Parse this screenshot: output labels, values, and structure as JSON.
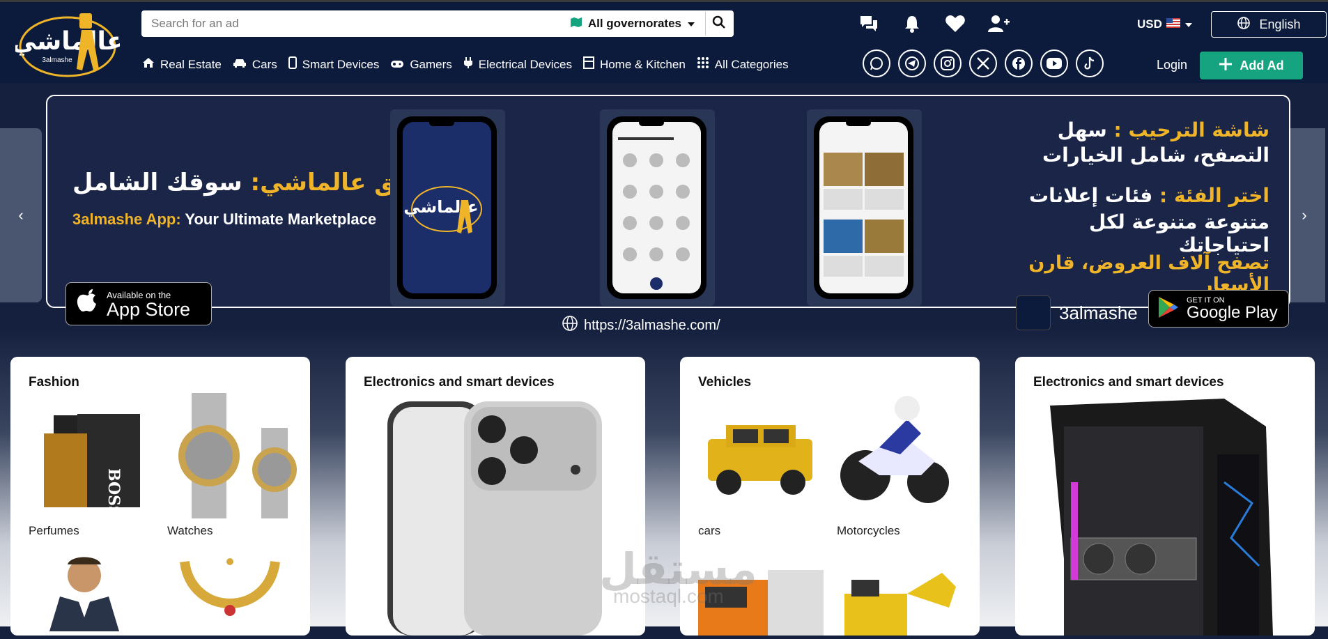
{
  "header": {
    "search_placeholder": "Search for an ad",
    "governorate": "All governorates",
    "currency": "USD",
    "language": "English",
    "login": "Login",
    "add_ad": "Add Ad",
    "logo_text": "عالماشي",
    "logo_sub": "3almashe"
  },
  "nav": [
    {
      "label": "Real Estate",
      "icon": "home-icon"
    },
    {
      "label": "Cars",
      "icon": "car-icon"
    },
    {
      "label": "Smart Devices",
      "icon": "phone-icon"
    },
    {
      "label": "Gamers",
      "icon": "gamepad-icon"
    },
    {
      "label": "Electrical Devices",
      "icon": "plug-icon"
    },
    {
      "label": "Home & Kitchen",
      "icon": "kitchen-icon"
    },
    {
      "label": "All Categories",
      "icon": "grid-icon"
    }
  ],
  "socials": [
    "whatsapp-icon",
    "telegram-icon",
    "instagram-icon",
    "x-icon",
    "facebook-icon",
    "youtube-icon",
    "tiktok-icon"
  ],
  "banner": {
    "ar_title_gold": "تطبيق عالماشي:",
    "ar_title_white": "سوقك الشامل",
    "en_gold": "3almashe App:",
    "en_white": "Your Ultimate Marketplace",
    "appstore_small": "Available on the",
    "appstore_big": "App Store",
    "line1_gold": "شاشة الترحيب :",
    "line1_white": "سهل",
    "line2": "التصفح، شامل الخيارات",
    "line3_gold": "اختر الفئة :",
    "line3_white": "فئات إعلانات",
    "line4": "متنوعة متنوعة لكل احتياجاتك",
    "line5": "تصفح آلاف العروض، قارن الأسعار",
    "url": "https://3almashe.com/",
    "brand": "3almashe",
    "gplay_small": "GET IT ON",
    "gplay_big": "Google Play"
  },
  "cards": [
    {
      "title": "Fashion",
      "items": [
        "Perfumes",
        "Watches"
      ]
    },
    {
      "title": "Electronics and smart devices"
    },
    {
      "title": "Vehicles",
      "items": [
        "cars",
        "Motorcycles"
      ]
    },
    {
      "title": "Electronics and smart devices"
    }
  ],
  "watermark": "مستقل",
  "watermark_sub": "mostaql.com",
  "colors": {
    "header_bg": "#0c1b3c",
    "accent_green": "#16a37f",
    "gold": "#f0b429"
  }
}
